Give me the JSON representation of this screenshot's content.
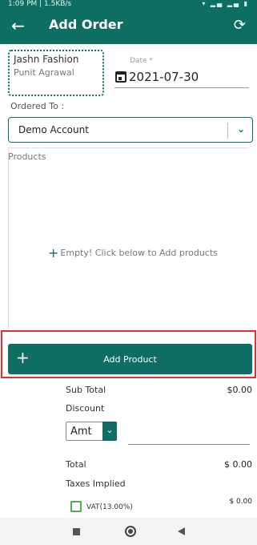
{
  "status_bar": {
    "left": "1:09 PM | 1.5KB/s",
    "right": "▾ ▂▄ ▂▄ ▮"
  },
  "header": {
    "title": "Add Order",
    "back_icon": "back-arrow-icon",
    "sync_icon": "sync-icon"
  },
  "from": {
    "name": "Jashn Fashion",
    "person": "Punit Agrawal"
  },
  "date": {
    "label": "Date *",
    "value": "2021-07-30"
  },
  "ordered_to": {
    "label": "Ordered To :",
    "value": "Demo Account"
  },
  "products": {
    "label": "Products",
    "empty_message": "Empty! Click below to Add products"
  },
  "add_product": {
    "label": "Add Product"
  },
  "summary": {
    "subtotal_label": "Sub Total",
    "subtotal_value": "$0.00",
    "discount_label": "Discount",
    "discount_type": "Amt",
    "total_label": "Total",
    "total_value": "$ 0.00",
    "taxes_label": "Taxes Implied",
    "vat_label": "VAT(13.00%)",
    "vat_value": "$ 0.00"
  },
  "colors": {
    "primary": "#0f6e63",
    "highlight": "#e03030",
    "checkbox": "#4caf50"
  }
}
